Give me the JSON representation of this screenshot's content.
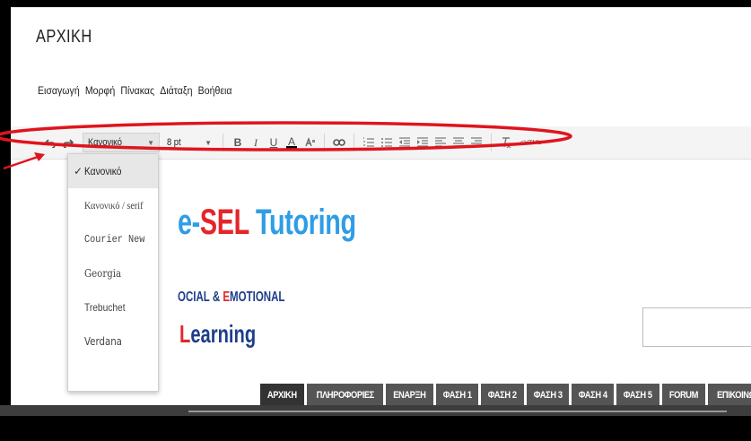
{
  "page": {
    "title": "ΑΡΧΙΚΗ"
  },
  "menubar": {
    "items": [
      "Εισαγωγή",
      "Μορφή",
      "Πίνακας",
      "Διάταξη",
      "Βοήθεια"
    ]
  },
  "toolbar": {
    "style_value": "Κανονικό",
    "size_value": "8 pt",
    "bold": "B",
    "italic": "I",
    "underline": "U",
    "font_color": "A",
    "html_label": "<HTML>"
  },
  "font_dropdown": {
    "items": [
      {
        "label": "Κανονικό",
        "selected": true
      },
      {
        "label": "Κανονικό / serif",
        "selected": false
      },
      {
        "label": "Courier New",
        "selected": false
      },
      {
        "label": "Georgia",
        "selected": false
      },
      {
        "label": "Trebuchet",
        "selected": false
      },
      {
        "label": "Verdana",
        "selected": false
      }
    ],
    "check": "✓"
  },
  "site": {
    "brand_prefix": "e-",
    "brand_sel": "SEL",
    "brand_tutoring": " Tutoring",
    "tagline_first": "OCIAL & ",
    "tagline_e": "E",
    "tagline_rest": "MOTIONAL",
    "learning_l": "L",
    "learning_rest": "earning"
  },
  "nav": {
    "items": [
      "ΑΡΧΙΚΗ",
      "ΠΛΗΡΟΦΟΡΙΕΣ",
      "ΕΝΑΡΞΗ",
      "ΦΑΣΗ 1",
      "ΦΑΣΗ 2",
      "ΦΑΣΗ 3",
      "ΦΑΣΗ 4",
      "ΦΑΣΗ 5",
      "FORUM",
      "ΕΠΙΚΟΙΝΩΝΙΑ"
    ]
  },
  "colors": {
    "annotation": "#e0141e",
    "brand_blue": "#1a8fd8",
    "brand_red": "#e3262b",
    "nav_bg": "#555555"
  }
}
